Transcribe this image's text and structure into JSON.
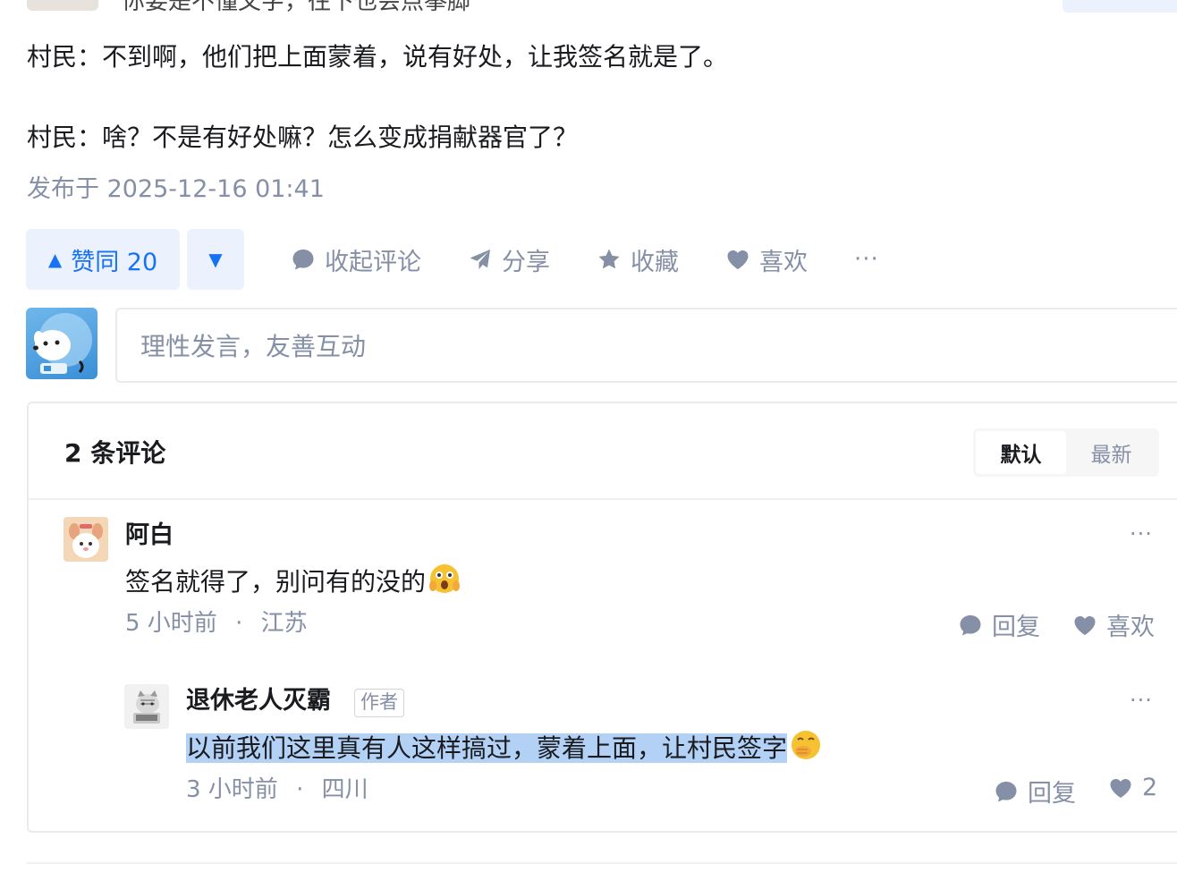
{
  "top": {
    "cut_text": "你要是不懂文字，往下也会点拳脚"
  },
  "article": {
    "paragraphs": [
      "村民：不到啊，他们把上面蒙着，说有好处，让我签名就是了。",
      "村民：啥？不是有好处嘛？怎么变成捐献器官了？"
    ],
    "published": "发布于 2025-12-16 01:41"
  },
  "actions": {
    "vote_up_label": "赞同 20",
    "vote_up_icon": "▲",
    "vote_down_icon": "▼",
    "collapse_comments": "收起评论",
    "share": "分享",
    "favorite": "收藏",
    "like": "喜欢",
    "more": "···"
  },
  "comment_input": {
    "placeholder": "理性发言，友善互动"
  },
  "comments": {
    "count_label": "2 条评论",
    "sort": {
      "default": "默认",
      "latest": "最新",
      "active": "default"
    },
    "items": [
      {
        "author": "阿白",
        "text": "签名就得了，别问有的没的",
        "emoji": "shocked-face",
        "time": "5 小时前",
        "sep": "·",
        "location": "江苏",
        "reply_label": "回复",
        "like_label": "喜欢",
        "more": "···"
      },
      {
        "author": "退休老人灭霸",
        "author_tag": "作者",
        "text": "以前我们这里真有人这样搞过，蒙着上面，让村民签字",
        "emoji": "hand-over-mouth-face",
        "time": "3 小时前",
        "sep": "·",
        "location": "四川",
        "reply_label": "回复",
        "like_count": "2",
        "more": "···"
      }
    ]
  },
  "colors": {
    "accent": "#1772f6",
    "vote_bg": "#ebf2fd",
    "muted": "#8590a6",
    "highlight": "#b3d0f5"
  }
}
